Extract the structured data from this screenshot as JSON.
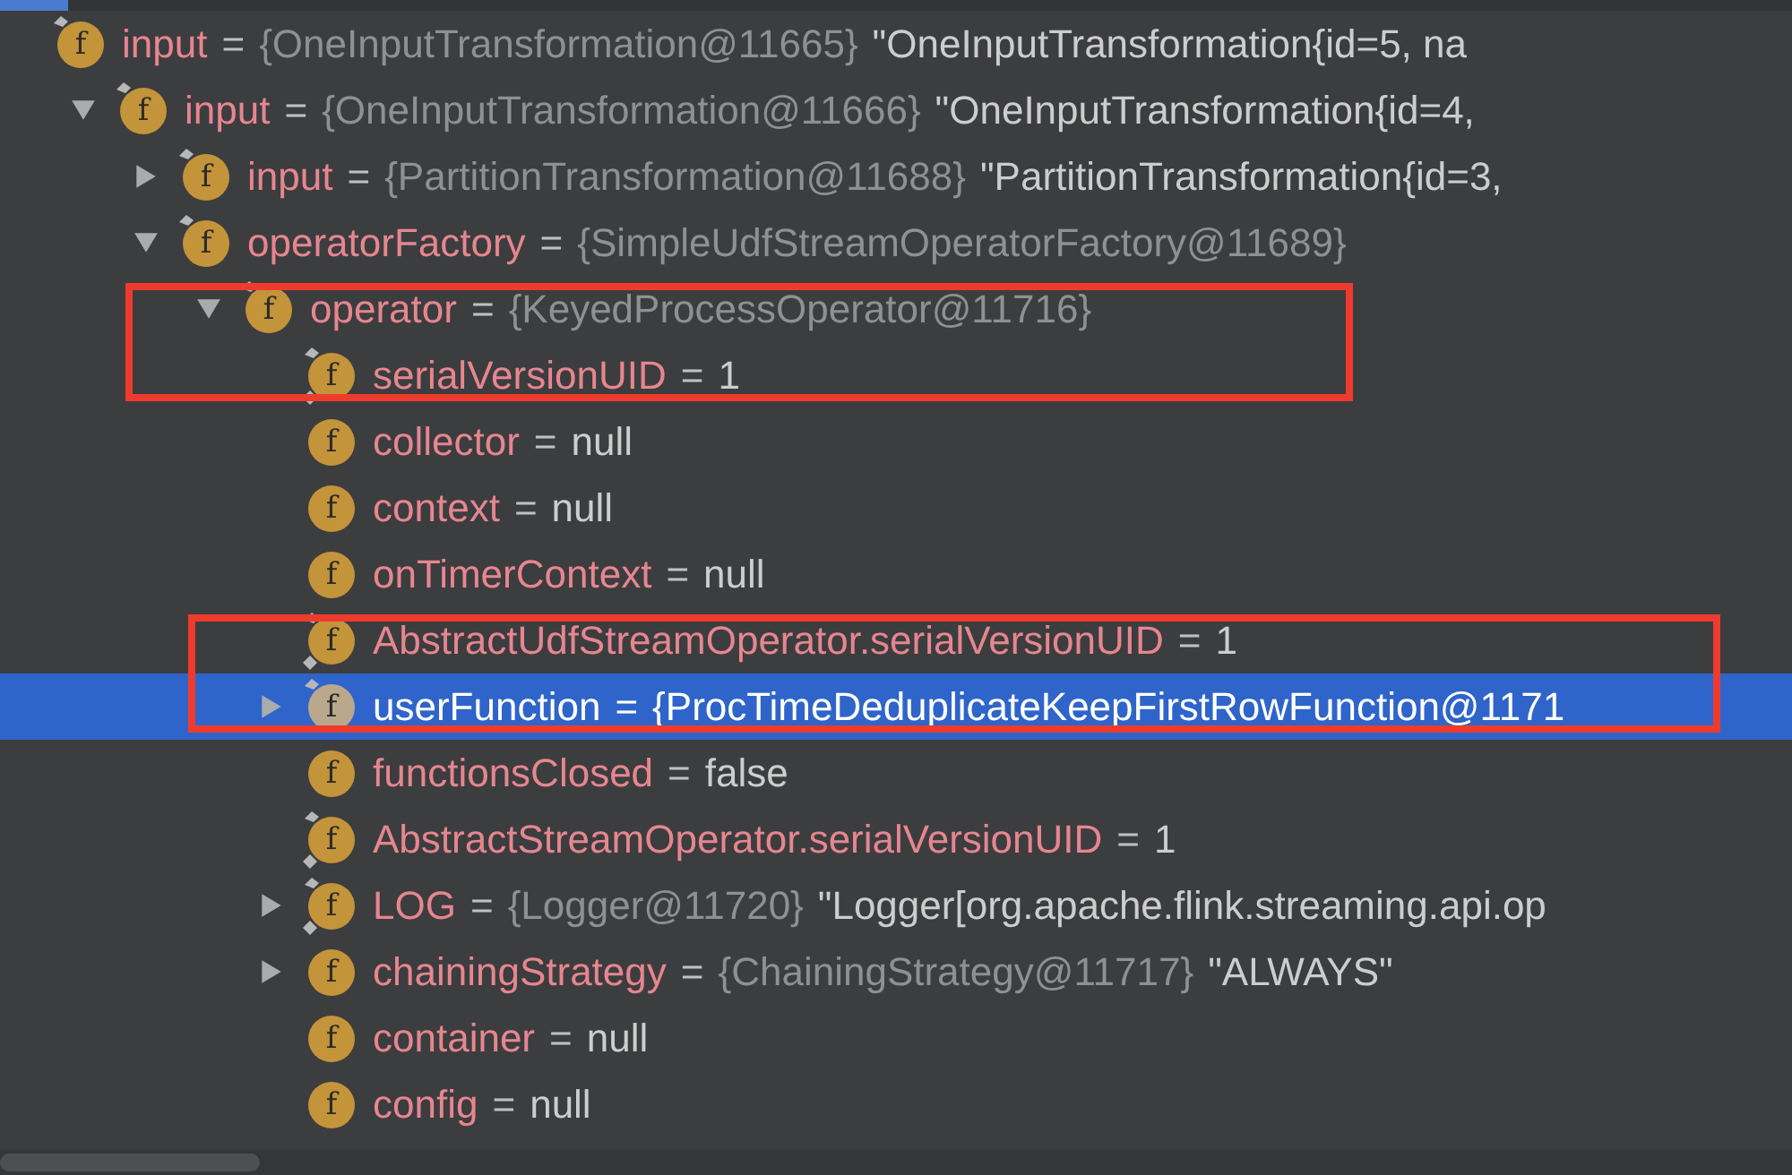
{
  "tree": [
    {
      "icon": "f",
      "name": "input",
      "eq": "=",
      "ref": "{OneInputTransformation@11665}",
      "value": "\"OneInputTransformation{id=5, na",
      "final": true,
      "static": false,
      "selected": false,
      "boxed": false,
      "children": [
        {
          "icon": "f",
          "name": "input",
          "eq": "=",
          "ref": "{OneInputTransformation@11666}",
          "value": "\"OneInputTransformation{id=4,",
          "final": true,
          "static": false,
          "selected": false,
          "boxed": false,
          "expanded": true,
          "children": [
            {
              "icon": "f",
              "name": "input",
              "eq": "=",
              "ref": "{PartitionTransformation@11688}",
              "value": "\"PartitionTransformation{id=3,",
              "final": true,
              "static": false,
              "selected": false,
              "boxed": false,
              "expanded": false
            },
            {
              "icon": "f",
              "name": "operatorFactory",
              "eq": "=",
              "ref": "{SimpleUdfStreamOperatorFactory@11689}",
              "final": true,
              "static": false,
              "selected": false,
              "boxed": false,
              "expanded": true,
              "children": [
                {
                  "icon": "f",
                  "name": "operator",
                  "eq": "=",
                  "ref": "{KeyedProcessOperator@11716}",
                  "final": true,
                  "static": false,
                  "selected": false,
                  "boxed": true,
                  "expanded": true,
                  "children": [
                    {
                      "icon": "f",
                      "name": "serialVersionUID",
                      "eq": "=",
                      "value": "1",
                      "final": true,
                      "static": true,
                      "selected": false,
                      "boxed": true
                    },
                    {
                      "icon": "f",
                      "name": "collector",
                      "eq": "=",
                      "value": "null",
                      "final": false,
                      "static": false,
                      "selected": false,
                      "boxed": false
                    },
                    {
                      "icon": "f",
                      "name": "context",
                      "eq": "=",
                      "value": "null",
                      "final": false,
                      "static": false,
                      "selected": false,
                      "boxed": false
                    },
                    {
                      "icon": "f",
                      "name": "onTimerContext",
                      "eq": "=",
                      "value": "null",
                      "final": false,
                      "static": false,
                      "selected": false,
                      "boxed": false
                    },
                    {
                      "icon": "f",
                      "name": "AbstractUdfStreamOperator.serialVersionUID",
                      "eq": "=",
                      "value": "1",
                      "final": true,
                      "static": true,
                      "selected": false,
                      "boxed": true
                    },
                    {
                      "icon": "f",
                      "name": "userFunction",
                      "eq": "=",
                      "ref": "{ProcTimeDeduplicateKeepFirstRowFunction@1171",
                      "final": true,
                      "static": false,
                      "selected": true,
                      "boxed": true,
                      "expanded": false
                    },
                    {
                      "icon": "f",
                      "name": "functionsClosed",
                      "eq": "=",
                      "value": "false",
                      "final": false,
                      "static": false,
                      "selected": false,
                      "boxed": false
                    },
                    {
                      "icon": "f",
                      "name": "AbstractStreamOperator.serialVersionUID",
                      "eq": "=",
                      "value": "1",
                      "final": true,
                      "static": true,
                      "selected": false,
                      "boxed": false
                    },
                    {
                      "icon": "f",
                      "name": "LOG",
                      "eq": "=",
                      "ref": "{Logger@11720}",
                      "value": "\"Logger[org.apache.flink.streaming.api.op",
                      "final": true,
                      "static": true,
                      "selected": false,
                      "boxed": false,
                      "expanded": false
                    },
                    {
                      "icon": "f",
                      "name": "chainingStrategy",
                      "eq": "=",
                      "ref": "{ChainingStrategy@11717}",
                      "value": "\"ALWAYS\"",
                      "final": false,
                      "static": false,
                      "selected": false,
                      "boxed": false,
                      "expanded": false
                    },
                    {
                      "icon": "f",
                      "name": "container",
                      "eq": "=",
                      "value": "null",
                      "final": false,
                      "static": false,
                      "selected": false,
                      "boxed": false
                    },
                    {
                      "icon": "f",
                      "name": "config",
                      "eq": "=",
                      "value": "null",
                      "final": false,
                      "static": false,
                      "selected": false,
                      "boxed": false
                    }
                  ]
                }
              ]
            }
          ]
        }
      ]
    }
  ]
}
